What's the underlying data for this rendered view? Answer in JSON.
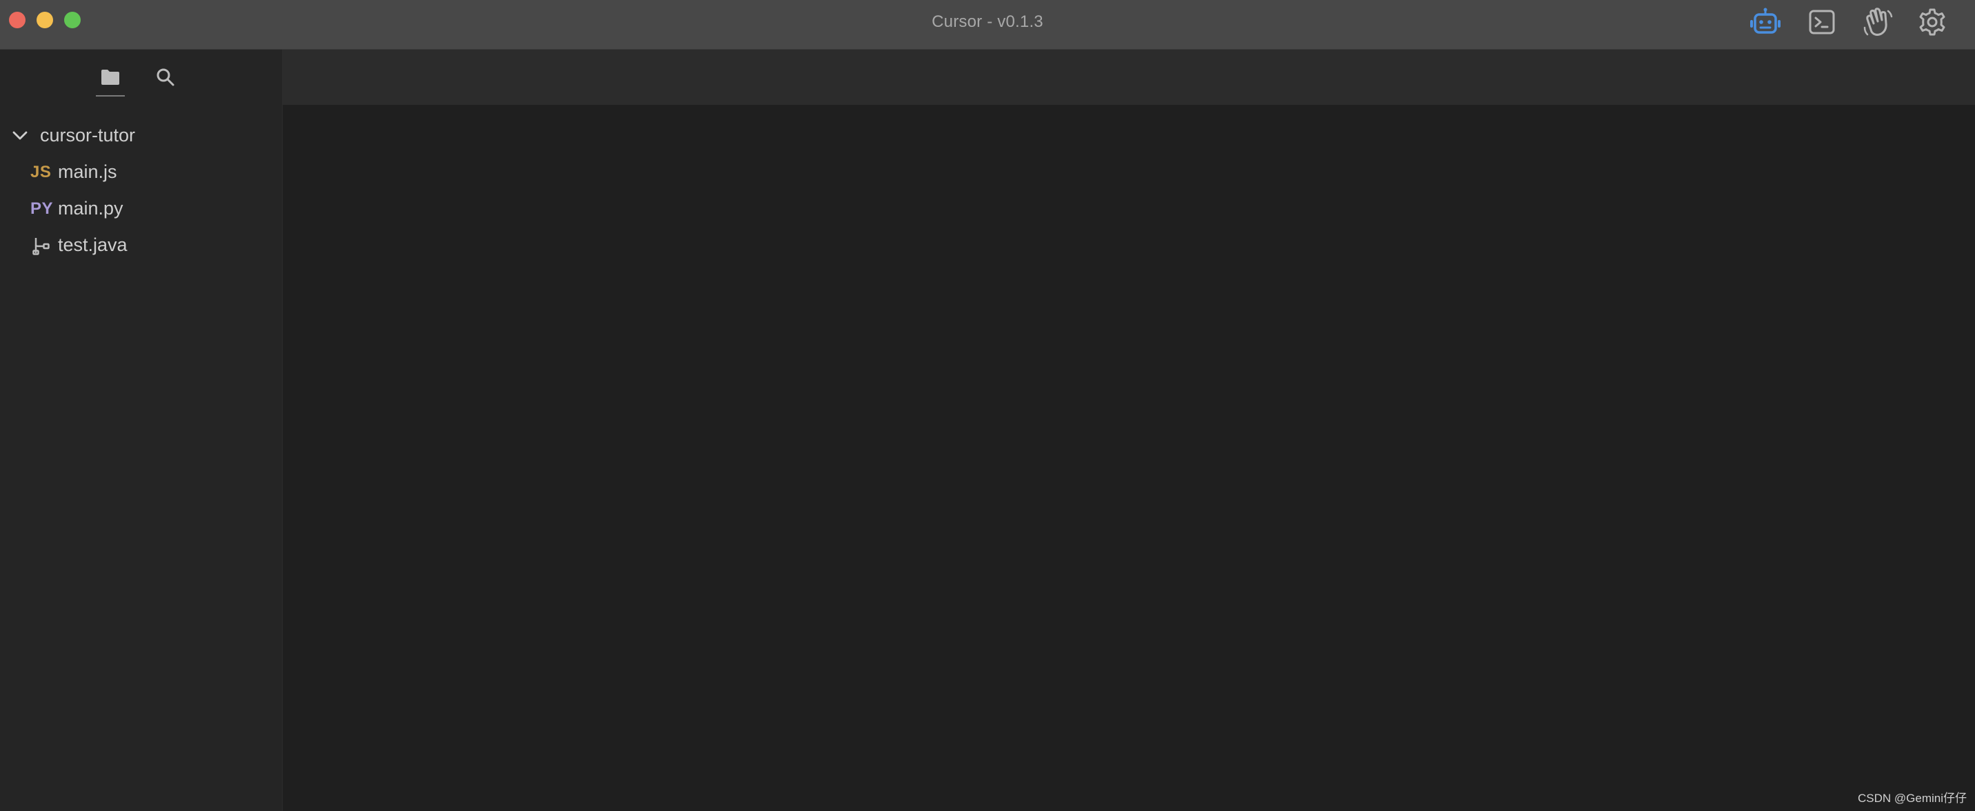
{
  "window": {
    "title": "Cursor - v0.1.3"
  },
  "titlebar": {
    "icons": [
      "robot-icon",
      "terminal-icon",
      "waving-hand-icon",
      "gear-icon"
    ],
    "accent_color": "#4a8fe0"
  },
  "sidebar": {
    "tabs": [
      "folder-icon",
      "search-icon"
    ],
    "folder": {
      "name": "cursor-tutor",
      "expanded": true
    },
    "files": [
      {
        "badge": "JS",
        "name": "main.js",
        "badge_color": "#c79a48"
      },
      {
        "badge": "PY",
        "name": "main.py",
        "badge_color": "#a89ad6"
      },
      {
        "badge": "",
        "name": "test.java",
        "icon": "git-branch-icon"
      }
    ]
  },
  "watermark": "CSDN @Gemini仔仔"
}
